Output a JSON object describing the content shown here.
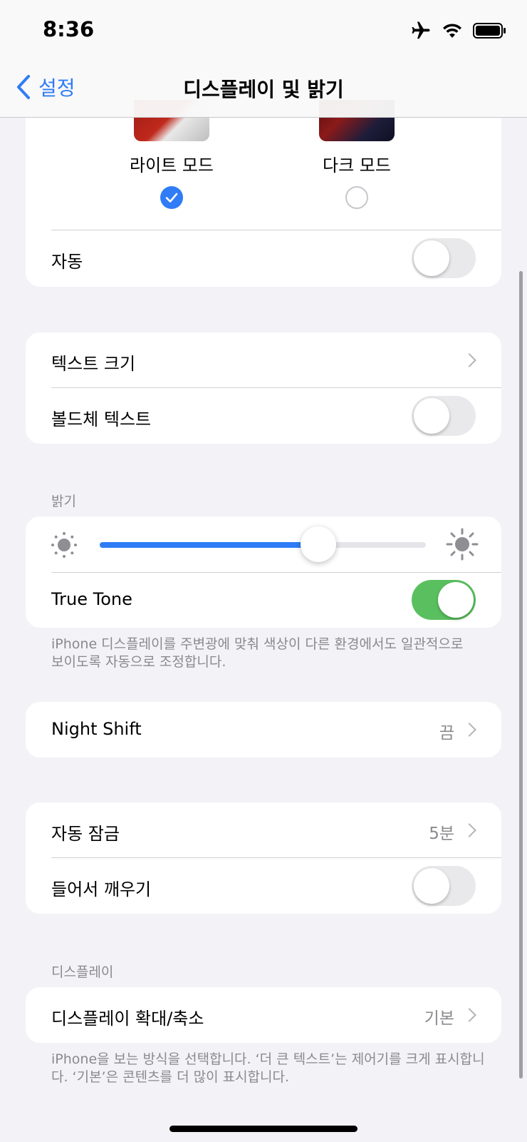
{
  "status_bar": {
    "time": "8:36"
  },
  "nav": {
    "back_label": "설정",
    "title": "디스플레이 및 밝기"
  },
  "appearance": {
    "light_label": "라이트 모드",
    "dark_label": "다크 모드",
    "selected": "light",
    "auto_label": "자동",
    "auto_on": false
  },
  "text": {
    "size_label": "텍스트 크기",
    "bold_label": "볼드체 텍스트",
    "bold_on": false
  },
  "brightness": {
    "header": "밝기",
    "level": 0.67,
    "true_tone_label": "True Tone",
    "true_tone_on": true,
    "footnote": "iPhone 디스플레이를 주변광에 맞춰 색상이 다른 환경에서도 일관적으로 보이도록 자동으로 조정합니다."
  },
  "night_shift": {
    "label": "Night Shift",
    "value": "끔"
  },
  "lock": {
    "auto_lock_label": "자동 잠금",
    "auto_lock_value": "5분",
    "raise_to_wake_label": "들어서 깨우기",
    "raise_to_wake_on": false
  },
  "display": {
    "header": "디스플레이",
    "zoom_label": "디스플레이 확대/축소",
    "zoom_value": "기본",
    "footnote": "iPhone을 보는 방식을 선택합니다. ‘더 큰 텍스트’는 제어기를 크게 표시합니다. ‘기본’은 콘텐츠를 더 많이 표시합니다."
  },
  "colors": {
    "accent": "#2f7cf6",
    "toggle_on": "#5ac05f"
  }
}
